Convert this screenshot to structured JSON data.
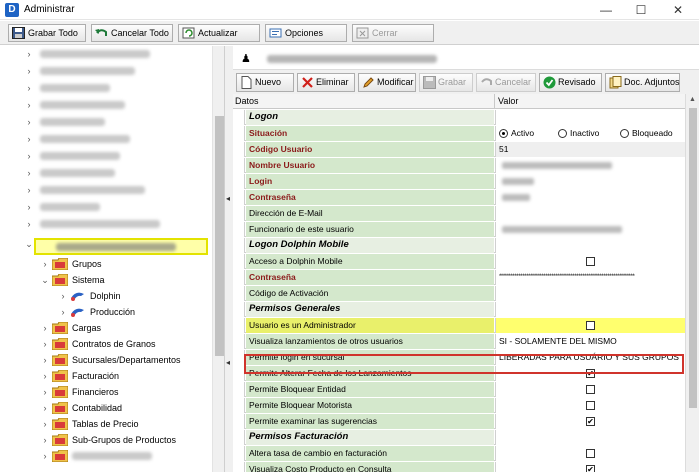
{
  "window": {
    "title": "Administrar",
    "controls": {
      "minimize": "—",
      "maximize": "☐",
      "close": "✕"
    }
  },
  "toolbar": {
    "save_all": "Grabar Todo",
    "cancel_all": "Cancelar Todo",
    "refresh": "Actualizar",
    "options": "Opciones",
    "close": "Cerrar"
  },
  "tree": {
    "items": [
      {
        "label": "Grupos"
      },
      {
        "label": "Sistema"
      },
      {
        "label": "Dolphin"
      },
      {
        "label": "Producción"
      },
      {
        "label": "Cargas"
      },
      {
        "label": "Contratos de Granos"
      },
      {
        "label": "Sucursales/Departamentos"
      },
      {
        "label": "Facturación"
      },
      {
        "label": "Financieros"
      },
      {
        "label": "Contabilidad"
      },
      {
        "label": "Tablas de Precio"
      },
      {
        "label": "Sub-Grupos de Productos"
      }
    ]
  },
  "subtoolbar": {
    "new": "Nuevo",
    "delete": "Eliminar",
    "modify": "Modificar",
    "save": "Grabar",
    "cancel": "Cancelar",
    "reviewed": "Revisado",
    "attached_docs": "Doc. Adjuntos"
  },
  "grid": {
    "col_data": "Datos",
    "col_value": "Valor",
    "sections": {
      "logon": "Logon",
      "logon_dolphin_mobile": "Logon Dolphin Mobile",
      "general_permissions": "Permisos Generales",
      "billing_permissions": "Permisos Facturación"
    },
    "rows": {
      "situation": "Situación",
      "situation_options": [
        "Activo",
        "Inactivo",
        "Bloqueado"
      ],
      "situation_selected": "Activo",
      "user_code": "Código Usuario",
      "user_code_value": "51",
      "user_name": "Nombre Usuario",
      "login": "Login",
      "password": "Contraseña",
      "email": "Dirección de E-Mail",
      "employee": "Funcionario de este usuario",
      "dolphin_mobile_access": "Acceso a Dolphin Mobile",
      "mobile_password": "Contraseña",
      "mobile_password_value": "**********************************************************************",
      "activation_code": "Código de Activación",
      "is_admin": "Usuario es un Administrador",
      "view_others_launches": "Visualiza lanzamientos de otros usuarios",
      "view_others_launches_value": "SI - SOLAMENTE DEL MISMO",
      "login_branch": "Permite login en sucursal",
      "login_branch_value": "LIBERADAS PARA USUÁRIO Y SUS GRUPOS",
      "alter_launch_date": "Permite Alterar Fecha de los Lanzamientos",
      "block_entity": "Permite Bloquear Entidad",
      "block_driver": "Permite Bloquear Motorista",
      "examine_suggestions": "Permite examinar las sugerencias",
      "alter_exchange_rate": "Altera tasa de cambio en facturación",
      "view_product_cost": "Visualiza Costo Producto en Consulta"
    },
    "checks": {
      "dolphin_mobile_access": false,
      "is_admin": false,
      "alter_launch_date": true,
      "block_entity": false,
      "block_driver": false,
      "examine_suggestions": true,
      "alter_exchange_rate": false,
      "view_product_cost": true
    }
  },
  "colors": {
    "label_green": "#d4e8cc",
    "required_red": "#8b1a1a",
    "tree_highlight": "#ffffa8",
    "admin_frame": "#d0342c"
  }
}
